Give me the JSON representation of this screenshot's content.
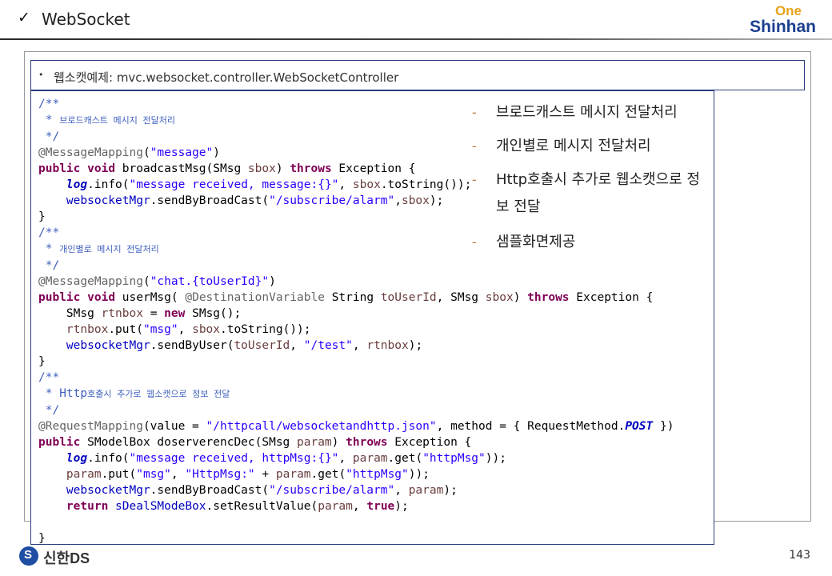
{
  "header": {
    "check_icon": "✓",
    "title": "WebSocket",
    "logo_line1": "One",
    "logo_line2": "Shinhan"
  },
  "breadcrumb": {
    "bullet": "•",
    "text": "웹소캣예제: mvc.websocket.controller.WebSocketController"
  },
  "notes": [
    {
      "dash": "-",
      "text": "브로드캐스트 메시지 전달처리"
    },
    {
      "dash": "-",
      "text": "개인별로 메시지 전달처리"
    },
    {
      "dash": "-",
      "text": "Http호출시 추가로 웹소캣으로 정보 전달"
    },
    {
      "dash": "-",
      "text": "샘플화면제공"
    }
  ],
  "footer": {
    "logo_mark": "S",
    "brand": "신한DS",
    "page_number": "143"
  },
  "code_lines": [
    [
      [
        "c-com",
        "/**"
      ]
    ],
    [
      [
        "c-com",
        " * "
      ],
      [
        "c-com small",
        "브로드캐스트 메시지 전달처리"
      ]
    ],
    [
      [
        "c-com",
        " */"
      ]
    ],
    [
      [
        "c-ann",
        "@MessageMapping"
      ],
      [
        "",
        "("
      ],
      [
        "c-str",
        "\"message\""
      ],
      [
        "",
        ")"
      ]
    ],
    [
      [
        "c-kw",
        "public"
      ],
      [
        "",
        " "
      ],
      [
        "c-kw",
        "void"
      ],
      [
        "",
        " broadcastMsg(SMsg "
      ],
      [
        "c-var",
        "sbox"
      ],
      [
        "",
        ") "
      ],
      [
        "c-kw",
        "throws"
      ],
      [
        "",
        " Exception {"
      ]
    ],
    [
      [
        "",
        "    "
      ],
      [
        "c-sfld",
        "log"
      ],
      [
        "",
        ".info("
      ],
      [
        "c-str",
        "\"message received, message:{}\""
      ],
      [
        "",
        ", "
      ],
      [
        "c-var",
        "sbox"
      ],
      [
        "",
        ".toString());"
      ]
    ],
    [
      [
        "",
        "    "
      ],
      [
        "c-fld",
        "websocketMgr"
      ],
      [
        "",
        ".sendByBroadCast("
      ],
      [
        "c-str",
        "\"/subscribe/alarm\""
      ],
      [
        "",
        ","
      ],
      [
        "c-var",
        "sbox"
      ],
      [
        "",
        ");"
      ]
    ],
    [
      [
        "",
        "}"
      ]
    ],
    [
      [
        "c-com",
        "/**"
      ]
    ],
    [
      [
        "c-com",
        " * "
      ],
      [
        "c-com small",
        "개인별로 메시지 전달처리"
      ]
    ],
    [
      [
        "c-com",
        " */"
      ]
    ],
    [
      [
        "c-ann",
        "@MessageMapping"
      ],
      [
        "",
        "("
      ],
      [
        "c-str",
        "\"chat.{toUserId}\""
      ],
      [
        "",
        ")"
      ]
    ],
    [
      [
        "c-kw",
        "public"
      ],
      [
        "",
        " "
      ],
      [
        "c-kw",
        "void"
      ],
      [
        "",
        " userMsg( "
      ],
      [
        "c-ann",
        "@DestinationVariable"
      ],
      [
        "",
        " String "
      ],
      [
        "c-var",
        "toUserId"
      ],
      [
        "",
        ", SMsg "
      ],
      [
        "c-var",
        "sbox"
      ],
      [
        "",
        ") "
      ],
      [
        "c-kw",
        "throws"
      ],
      [
        "",
        " Exception {"
      ]
    ],
    [
      [
        "",
        "    SMsg "
      ],
      [
        "c-var",
        "rtnbox"
      ],
      [
        "",
        " = "
      ],
      [
        "c-kw",
        "new"
      ],
      [
        "",
        " SMsg();"
      ]
    ],
    [
      [
        "",
        "    "
      ],
      [
        "c-var",
        "rtnbox"
      ],
      [
        "",
        ".put("
      ],
      [
        "c-str",
        "\"msg\""
      ],
      [
        "",
        ", "
      ],
      [
        "c-var",
        "sbox"
      ],
      [
        "",
        ".toString());"
      ]
    ],
    [
      [
        "",
        "    "
      ],
      [
        "c-fld",
        "websocketMgr"
      ],
      [
        "",
        ".sendByUser("
      ],
      [
        "c-var",
        "toUserId"
      ],
      [
        "",
        ", "
      ],
      [
        "c-str",
        "\"/test\""
      ],
      [
        "",
        ", "
      ],
      [
        "c-var",
        "rtnbox"
      ],
      [
        "",
        ");"
      ]
    ],
    [
      [
        "",
        "}"
      ]
    ],
    [
      [
        "c-com",
        "/**"
      ]
    ],
    [
      [
        "c-com",
        " * Http"
      ],
      [
        "c-com small",
        "호출시 추가로 웹소캣으로 정보 전달"
      ]
    ],
    [
      [
        "c-com",
        " */"
      ]
    ],
    [
      [
        "c-ann",
        "@RequestMapping"
      ],
      [
        "",
        "(value = "
      ],
      [
        "c-str",
        "\"/httpcall/websocketandhttp.json\""
      ],
      [
        "",
        ", method = { RequestMethod."
      ],
      [
        "c-sfld",
        "POST"
      ],
      [
        "",
        " })"
      ]
    ],
    [
      [
        "c-kw",
        "public"
      ],
      [
        "",
        " SModelBox doserverencDec(SMsg "
      ],
      [
        "c-var",
        "param"
      ],
      [
        "",
        ") "
      ],
      [
        "c-kw",
        "throws"
      ],
      [
        "",
        " Exception {"
      ]
    ],
    [
      [
        "",
        "    "
      ],
      [
        "c-sfld",
        "log"
      ],
      [
        "",
        ".info("
      ],
      [
        "c-str",
        "\"message received, httpMsg:{}\""
      ],
      [
        "",
        ", "
      ],
      [
        "c-var",
        "param"
      ],
      [
        "",
        ".get("
      ],
      [
        "c-str",
        "\"httpMsg\""
      ],
      [
        "",
        "));"
      ]
    ],
    [
      [
        "",
        "    "
      ],
      [
        "c-var",
        "param"
      ],
      [
        "",
        ".put("
      ],
      [
        "c-str",
        "\"msg\""
      ],
      [
        "",
        ", "
      ],
      [
        "c-str",
        "\"HttpMsg:\""
      ],
      [
        "",
        " + "
      ],
      [
        "c-var",
        "param"
      ],
      [
        "",
        ".get("
      ],
      [
        "c-str",
        "\"httpMsg\""
      ],
      [
        "",
        "));"
      ]
    ],
    [
      [
        "",
        "    "
      ],
      [
        "c-fld",
        "websocketMgr"
      ],
      [
        "",
        ".sendByBroadCast("
      ],
      [
        "c-str",
        "\"/subscribe/alarm\""
      ],
      [
        "",
        ", "
      ],
      [
        "c-var",
        "param"
      ],
      [
        "",
        ");"
      ]
    ],
    [
      [
        "",
        "    "
      ],
      [
        "c-kw",
        "return"
      ],
      [
        "",
        " "
      ],
      [
        "c-fld",
        "sDealSModeBox"
      ],
      [
        "",
        ".setResultValue("
      ],
      [
        "c-var",
        "param"
      ],
      [
        "",
        ", "
      ],
      [
        "c-kw",
        "true"
      ],
      [
        "",
        ");"
      ]
    ],
    [
      [
        "",
        ""
      ]
    ],
    [
      [
        "",
        "}"
      ]
    ]
  ]
}
